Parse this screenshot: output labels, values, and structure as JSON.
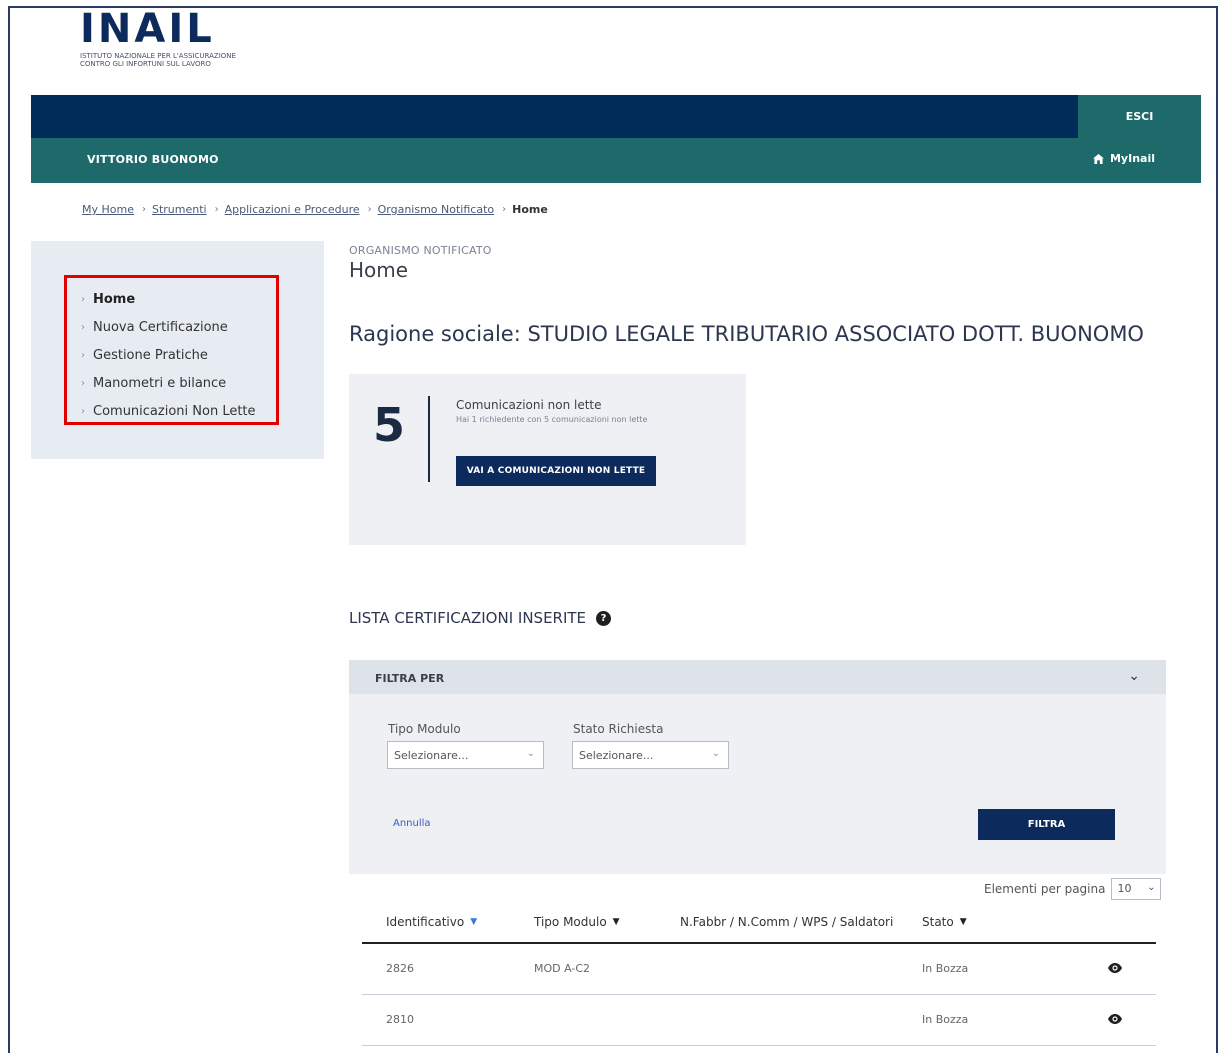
{
  "logo": {
    "mark": "INAIL",
    "sub": "ISTITUTO NAZIONALE PER L'ASSICURAZIONE CONTRO GLI INFORTUNI SUL LAVORO"
  },
  "header": {
    "esci": "ESCI",
    "username": "VITTORIO BUONOMO",
    "myinail": "MyInail"
  },
  "breadcrumb": {
    "items": [
      "My Home",
      "Strumenti",
      "Applicazioni e Procedure",
      "Organismo Notificato"
    ],
    "current": "Home"
  },
  "sidebar": {
    "items": [
      {
        "label": "Home"
      },
      {
        "label": "Nuova Certificazione"
      },
      {
        "label": "Gestione Pratiche"
      },
      {
        "label": "Manometri e bilance"
      },
      {
        "label": "Comunicazioni Non Lette"
      }
    ]
  },
  "main": {
    "eyebrow": "ORGANISMO NOTIFICATO",
    "title": "Home",
    "ragione": "Ragione sociale: STUDIO LEGALE TRIBUTARIO ASSOCIATO DOTT. BUONOMO"
  },
  "card": {
    "number": "5",
    "title": "Comunicazioni non lette",
    "sub": "Hai 1 richiedente con 5 comunicazioni non lette",
    "button": "VAI A COMUNICAZIONI NON LETTE"
  },
  "lista": {
    "title": "LISTA CERTIFICAZIONI INSERITE",
    "help": "?"
  },
  "filter": {
    "header": "FILTRA PER",
    "tipo_label": "Tipo Modulo",
    "tipo_placeholder": "Selezionare...",
    "stato_label": "Stato Richiesta",
    "stato_placeholder": "Selezionare...",
    "annulla": "Annulla",
    "filtra": "FILTRA"
  },
  "pagination": {
    "label": "Elementi per pagina",
    "value": "10"
  },
  "table": {
    "columns": [
      "Identificativo",
      "Tipo Modulo",
      "N.Fabbr / N.Comm / WPS / Saldatori",
      "Stato"
    ],
    "rows": [
      {
        "id": "2826",
        "tipo": "MOD A-C2",
        "nfabbr": "",
        "stato": "In Bozza"
      },
      {
        "id": "2810",
        "tipo": "",
        "nfabbr": "",
        "stato": "In Bozza"
      }
    ]
  }
}
